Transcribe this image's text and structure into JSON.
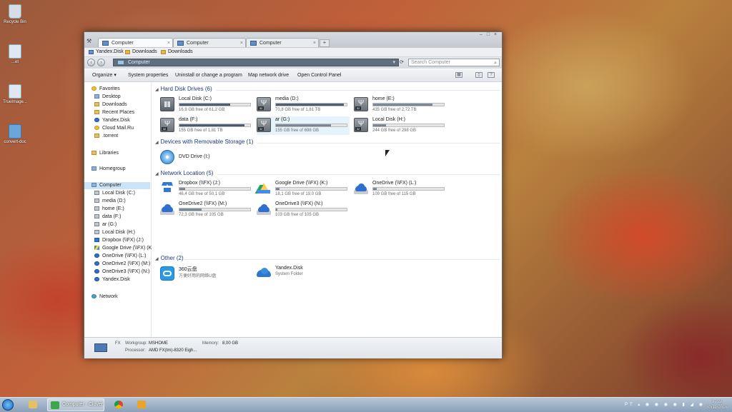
{
  "desktop": {
    "icons": [
      {
        "label": "Recycle Bin"
      },
      {
        "label": "...et"
      },
      {
        "label": "TrueImage..."
      },
      {
        "label": "convert-doc"
      }
    ]
  },
  "window": {
    "tabs": [
      {
        "label": "Computer"
      },
      {
        "label": "Computer"
      },
      {
        "label": "Computer"
      }
    ],
    "favorites_bar": [
      "Yandex.Disk",
      "Downloads",
      "Downloads"
    ],
    "address": "Computer",
    "search_placeholder": "Search Computer",
    "commands": [
      "Organize ▾",
      "System properties",
      "Uninstall or change a program",
      "Map network drive",
      "Open Control Panel"
    ],
    "nav": {
      "favorites_header": "Favorites",
      "favorites": [
        "Desktop",
        "Downloads",
        "Recent Places",
        "Yandex.Disk",
        "Cloud Mail.Ru",
        ".torrent"
      ],
      "libraries": "Libraries",
      "homegroup": "Homegroup",
      "computer": "Computer",
      "computer_items": [
        "Local Disk (C:)",
        "media (D:)",
        "home (E:)",
        "data (F:)",
        "ar (G:)",
        "Local Disk (H:)",
        "Dropbox (\\\\FX) (J:)",
        "Google Drive (\\\\FX) (K:)",
        "OneDrive (\\\\FX) (L:)",
        "OneDrive2 (\\\\FX) (M:)",
        "OneDrive3 (\\\\FX) (N:)",
        "Yandex.Disk"
      ],
      "network": "Network"
    },
    "sections": {
      "hdd": "Hard Disk Drives (6)",
      "removable": "Devices with Removable Storage (1)",
      "network": "Network Location (5)",
      "other": "Other (2)"
    },
    "hdd": [
      {
        "name": "Local Disk (C:)",
        "free": "16,9 GB free of 61,2 GB",
        "used": 0.72
      },
      {
        "name": "media (D:)",
        "free": "70,8 GB free of 1,81 TB",
        "used": 0.96
      },
      {
        "name": "home (E:)",
        "free": "435 GB free of 2,72 TB",
        "used": 0.84
      },
      {
        "name": "data (F:)",
        "free": "155 GB free of 1,81 TB",
        "used": 0.92
      },
      {
        "name": "ar (G:)",
        "free": "155 GB free of 698 GB",
        "used": 0.78
      },
      {
        "name": "Local Disk (H:)",
        "free": "244 GB free of 298 GB",
        "used": 0.18
      }
    ],
    "removable": [
      {
        "name": "DVD Drive (I:)"
      }
    ],
    "network": [
      {
        "name": "Dropbox (\\\\FX) (J:)",
        "free": "46,4 GB free of 50,1 GB",
        "used": 0.08
      },
      {
        "name": "Google Drive (\\\\FX) (K:)",
        "free": "18,1 GB free of 19,0 GB",
        "used": 0.05
      },
      {
        "name": "OneDrive (\\\\FX) (L:)",
        "free": "109 GB free of 115 GB",
        "used": 0.05
      },
      {
        "name": "OneDrive2 (\\\\FX) (M:)",
        "free": "72,3 GB free of 105 GB",
        "used": 0.31
      },
      {
        "name": "OneDrive3 (\\\\FX) (N:)",
        "free": "103 GB free of 105 GB",
        "used": 0.02
      }
    ],
    "other": [
      {
        "name": "360云盘",
        "sub": "方便好用的网络U盘"
      },
      {
        "name": "Yandex.Disk",
        "sub": "System Folder"
      }
    ],
    "details": {
      "pc_name": "FX",
      "workgroup_label": "Workgroup:",
      "workgroup": "MSHOME",
      "memory_label": "Memory:",
      "memory": "8,00 GB",
      "processor_label": "Processor:",
      "processor": "AMD FX(tm)-8320 Eigh..."
    }
  },
  "taskbar": {
    "active_label": "Computer - Clover",
    "lang": "PT",
    "time": "17:22",
    "date": "30/11/2016"
  }
}
